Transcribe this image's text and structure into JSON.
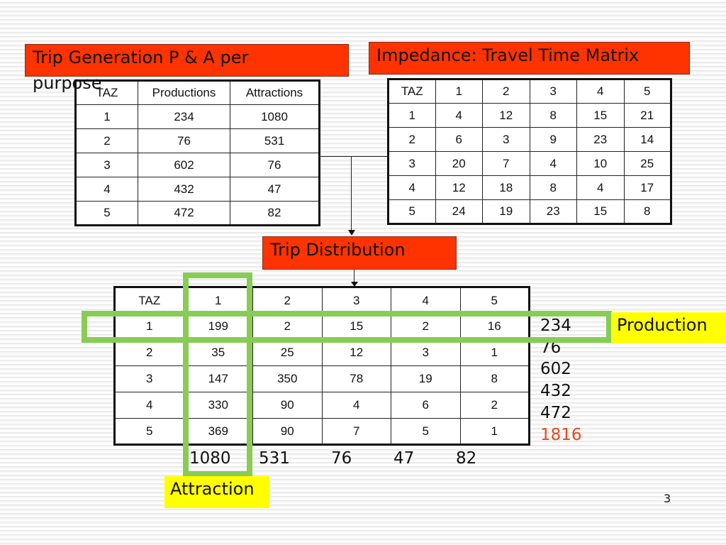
{
  "slide": {
    "page_number": "3",
    "trip_generation": {
      "title_line1": "Trip Generation P & A per",
      "title_line2": "purpose",
      "headers": [
        "TAZ",
        "Productions",
        "Attractions"
      ],
      "rows": [
        [
          "1",
          "234",
          "1080"
        ],
        [
          "2",
          "76",
          "531"
        ],
        [
          "3",
          "602",
          "76"
        ],
        [
          "4",
          "432",
          "47"
        ],
        [
          "5",
          "472",
          "82"
        ]
      ]
    },
    "impedance": {
      "title": "Impedance: Travel Time Matrix",
      "headers": [
        "TAZ",
        "1",
        "2",
        "3",
        "4",
        "5"
      ],
      "rows": [
        [
          "1",
          "4",
          "12",
          "8",
          "15",
          "21"
        ],
        [
          "2",
          "6",
          "3",
          "9",
          "23",
          "14"
        ],
        [
          "3",
          "20",
          "7",
          "4",
          "10",
          "25"
        ],
        [
          "4",
          "12",
          "18",
          "8",
          "4",
          "17"
        ],
        [
          "5",
          "24",
          "19",
          "23",
          "15",
          "8"
        ]
      ]
    },
    "trip_distribution": {
      "title": "Trip Distribution",
      "headers": [
        "TAZ",
        "1",
        "2",
        "3",
        "4",
        "5"
      ],
      "rows": [
        [
          "1",
          "199",
          "2",
          "15",
          "2",
          "16"
        ],
        [
          "2",
          "35",
          "25",
          "12",
          "3",
          "1"
        ],
        [
          "3",
          "147",
          "350",
          "78",
          "19",
          "8"
        ],
        [
          "4",
          "330",
          "90",
          "4",
          "6",
          "2"
        ],
        [
          "5",
          "369",
          "90",
          "7",
          "5",
          "1"
        ]
      ],
      "production_totals": [
        "234",
        "76",
        "602",
        "432",
        "472"
      ],
      "production_grand_total": "1816",
      "attraction_totals": [
        "1080",
        "531",
        "76",
        "47",
        "82"
      ],
      "production_label": "Production",
      "attraction_label": "Attraction"
    },
    "colors": {
      "title_box": "#ff3300",
      "highlight_box": "#ffff00",
      "highlight_outline": "#88cc55",
      "grand_total_text": "#e8481c"
    }
  }
}
